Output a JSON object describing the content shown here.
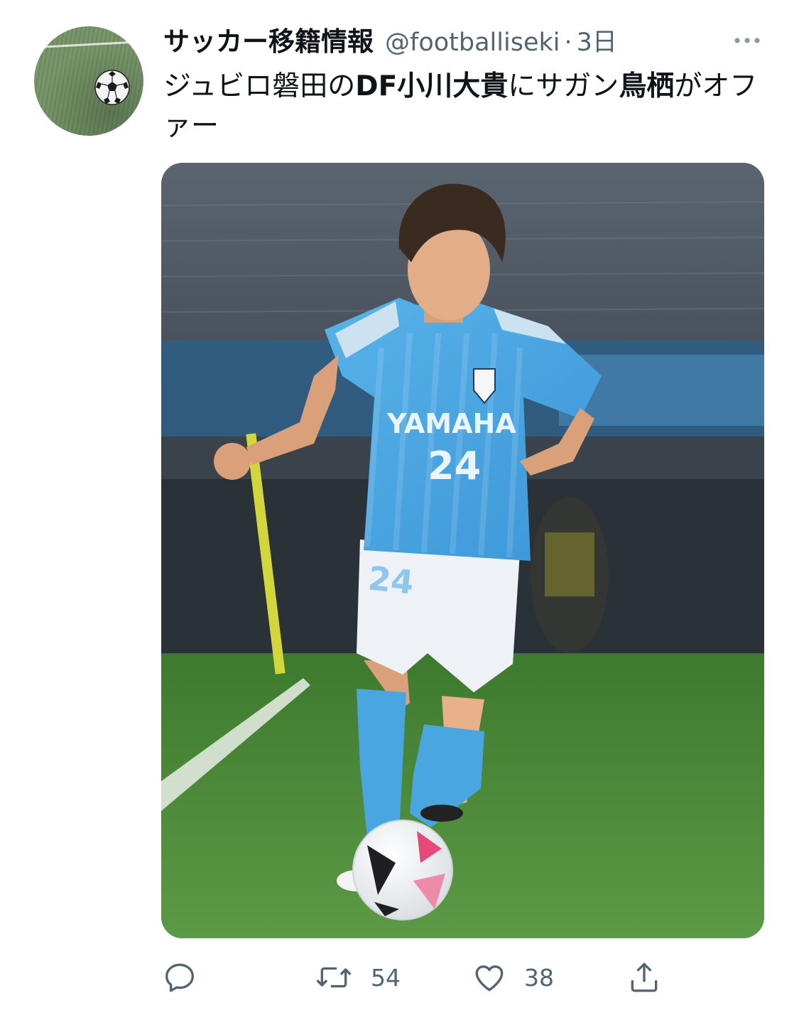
{
  "tweet": {
    "display_name": "サッカー移籍情報",
    "handle": "@footballiseki",
    "separator": "·",
    "time": "3日",
    "text_segments": [
      {
        "text": "ジュビロ磐田の",
        "bold": false
      },
      {
        "text": "DF小川大貴",
        "bold": true
      },
      {
        "text": "にサガン",
        "bold": false
      },
      {
        "text": "鳥栖",
        "bold": true
      },
      {
        "text": "がオファー",
        "bold": false
      }
    ]
  },
  "media": {
    "jersey_sponsor": "YAMAHA",
    "jersey_number": "24"
  },
  "actions": {
    "reply_count": "",
    "retweet_count": "54",
    "like_count": "38"
  },
  "colors": {
    "text_primary": "#0f1419",
    "text_secondary": "#536471",
    "jersey_blue": "#4aa6e0",
    "pitch_green": "#4f8a3a"
  },
  "icons": {
    "more": "more-horizontal-icon",
    "reply": "reply-bubble-icon",
    "retweet": "retweet-icon",
    "like": "heart-icon",
    "share": "share-upload-icon",
    "avatar": "soccer-ball-icon"
  }
}
